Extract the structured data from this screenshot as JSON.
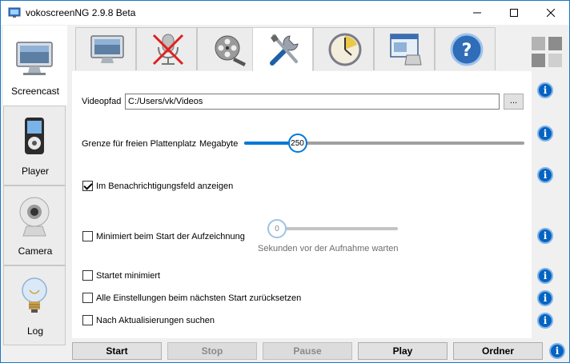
{
  "window": {
    "title": "vokoscreenNG 2.9.8 Beta"
  },
  "sidebar": {
    "items": [
      {
        "label": "Screencast",
        "icon": "monitor-icon",
        "active": true
      },
      {
        "label": "Player",
        "icon": "media-player-icon",
        "active": false
      },
      {
        "label": "Camera",
        "icon": "webcam-icon",
        "active": false
      },
      {
        "label": "Log",
        "icon": "lightbulb-icon",
        "active": false
      }
    ]
  },
  "tabs": [
    {
      "icon": "monitor-icon",
      "active": false
    },
    {
      "icon": "microphone-muted-icon",
      "active": false
    },
    {
      "icon": "film-reel-icon",
      "active": false
    },
    {
      "icon": "tools-icon",
      "active": true
    },
    {
      "icon": "clock-timer-icon",
      "active": false
    },
    {
      "icon": "screen-window-icon",
      "active": false
    },
    {
      "icon": "help-icon",
      "active": false
    }
  ],
  "settings": {
    "video_path_label": "Videopfad",
    "video_path_value": "C:/Users/vk/Videos",
    "browse_label": "...",
    "disk_space_label": "Grenze für freien Plattenplatz",
    "disk_space_unit": "Megabyte",
    "disk_space_value": "250",
    "disk_space_fraction": 0.19,
    "tray_label": "Im Benachrichtigungsfeld anzeigen",
    "tray_checked": true,
    "minimize_on_start_label": "Minimiert beim Start der Aufzeichnung",
    "minimize_on_start_checked": false,
    "wait_value": "0",
    "wait_fraction": 0.0,
    "wait_caption": "Sekunden vor der Aufnahme warten",
    "start_minimized_label": "Startet minimiert",
    "start_minimized_checked": false,
    "reset_label": "Alle Einstellungen beim nächsten Start zurücksetzen",
    "reset_checked": false,
    "check_updates_label": "Nach Aktualisierungen suchen",
    "check_updates_checked": false,
    "info_symbol": "i"
  },
  "buttons": {
    "start": "Start",
    "stop": "Stop",
    "pause": "Pause",
    "play": "Play",
    "folder": "Ordner"
  },
  "colors": {
    "accent": "#0078d7",
    "info": "#0563c1"
  }
}
